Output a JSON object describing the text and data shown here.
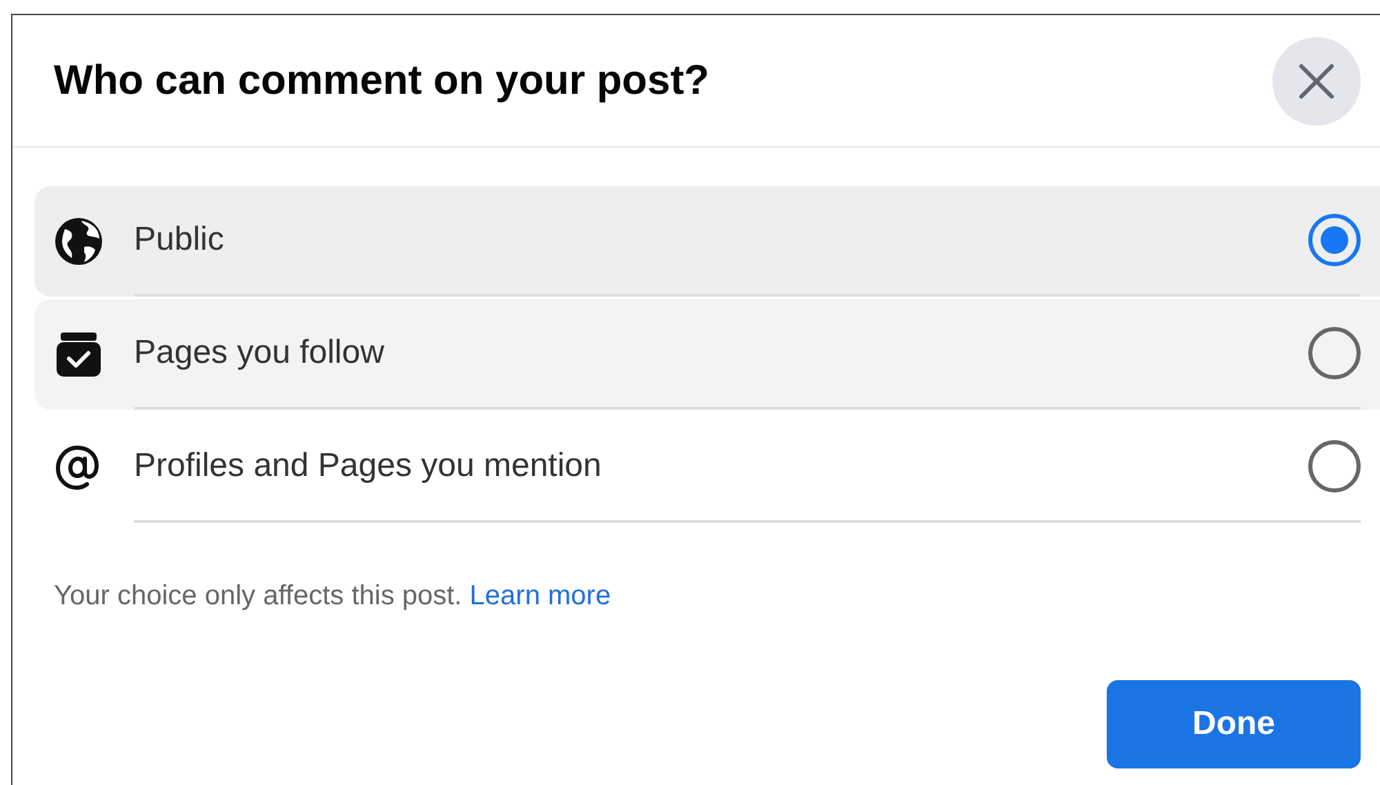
{
  "dialog": {
    "title": "Who can comment on your post?",
    "options": [
      {
        "kind": "globe",
        "label": "Public",
        "selected": true,
        "hovered": false
      },
      {
        "kind": "pages",
        "label": "Pages you follow",
        "selected": false,
        "hovered": true
      },
      {
        "kind": "mention",
        "label": "Profiles and Pages you mention",
        "selected": false,
        "hovered": false
      }
    ],
    "note": "Your choice only affects this post.",
    "link": "Learn more",
    "button": "Done"
  }
}
